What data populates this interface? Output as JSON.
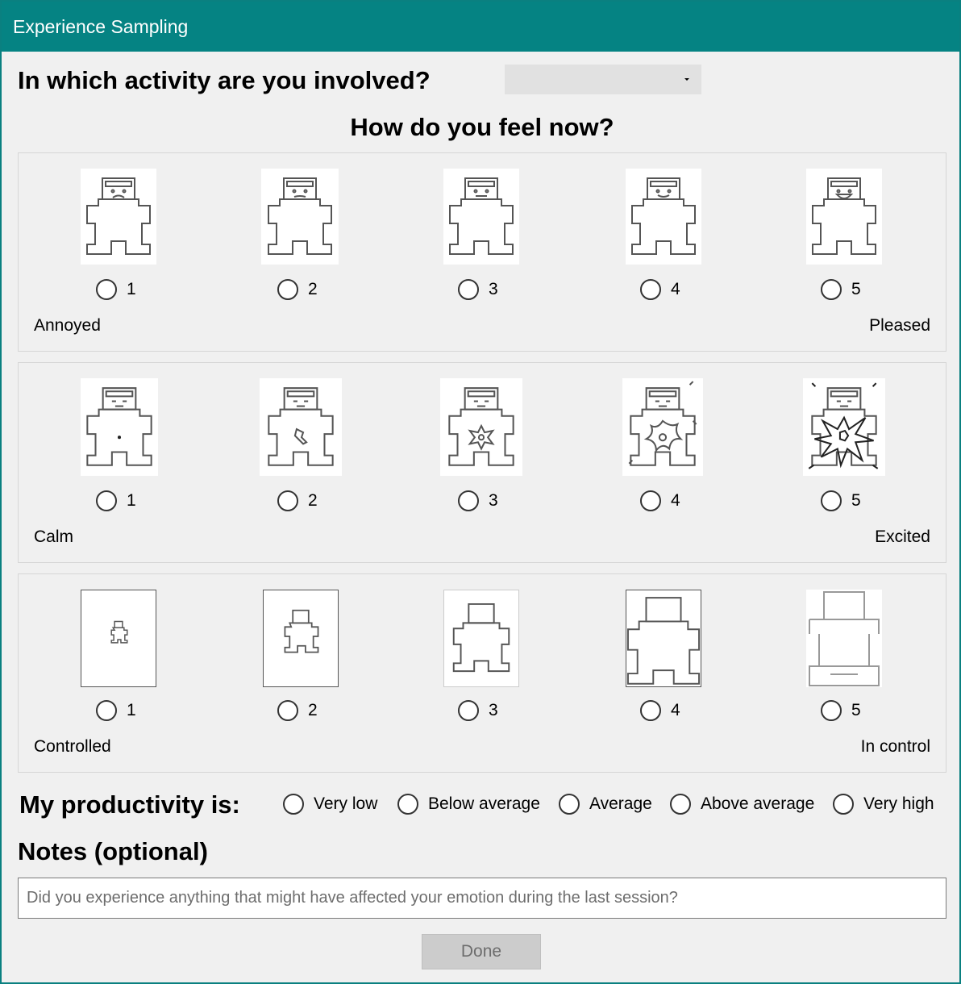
{
  "window": {
    "title": "Experience Sampling"
  },
  "activity": {
    "question": "In which activity are you involved?",
    "selected": ""
  },
  "feel": {
    "question": "How do you feel now?",
    "scales": [
      {
        "left": "Annoyed",
        "right": "Pleased",
        "options": [
          "1",
          "2",
          "3",
          "4",
          "5"
        ]
      },
      {
        "left": "Calm",
        "right": "Excited",
        "options": [
          "1",
          "2",
          "3",
          "4",
          "5"
        ]
      },
      {
        "left": "Controlled",
        "right": "In control",
        "options": [
          "1",
          "2",
          "3",
          "4",
          "5"
        ]
      }
    ]
  },
  "productivity": {
    "question": "My productivity is:",
    "options": [
      "Very low",
      "Below average",
      "Average",
      "Above average",
      "Very high"
    ]
  },
  "notes": {
    "question": "Notes (optional)",
    "placeholder": "Did you experience anything that might have affected your emotion during the last session?",
    "value": ""
  },
  "done": {
    "label": "Done",
    "enabled": false
  }
}
